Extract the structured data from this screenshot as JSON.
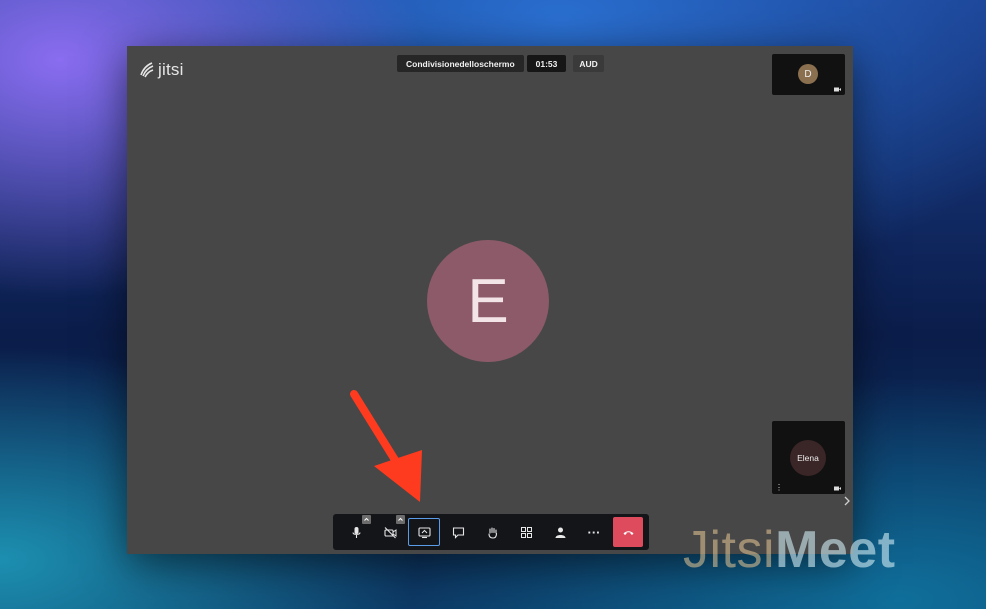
{
  "brand": {
    "logo_text": "jitsi"
  },
  "top_bar": {
    "title": "Condivisionedelloschermo",
    "timer": "01:53",
    "badge": "AUD"
  },
  "participants": {
    "thumb_top_initial": "D",
    "thumb_bottom_name": "Elena",
    "dots_label": "⋮"
  },
  "main_avatar": {
    "initial": "E",
    "color": "#8c5a69"
  },
  "toolbar": {
    "buttons": [
      {
        "name": "microphone",
        "icon": "mic-icon",
        "has_caret": true
      },
      {
        "name": "camera",
        "icon": "camera-off-icon",
        "has_caret": true
      },
      {
        "name": "screen-share",
        "icon": "screen-share-icon",
        "active": true
      },
      {
        "name": "chat",
        "icon": "chat-icon"
      },
      {
        "name": "raise-hand",
        "icon": "hand-icon"
      },
      {
        "name": "tile-view",
        "icon": "grid-icon"
      },
      {
        "name": "participants",
        "icon": "person-icon"
      },
      {
        "name": "more",
        "icon": "more-icon",
        "label": "···"
      },
      {
        "name": "hang-up",
        "icon": "phone-hangup-icon"
      }
    ]
  },
  "watermark": {
    "part1": "Jitsi",
    "part2": "Meet"
  },
  "colors": {
    "window_bg": "#474747",
    "active_outline": "#5b9ce8",
    "hangup": "#dd4b5c",
    "arrow": "#ff3b1f"
  }
}
